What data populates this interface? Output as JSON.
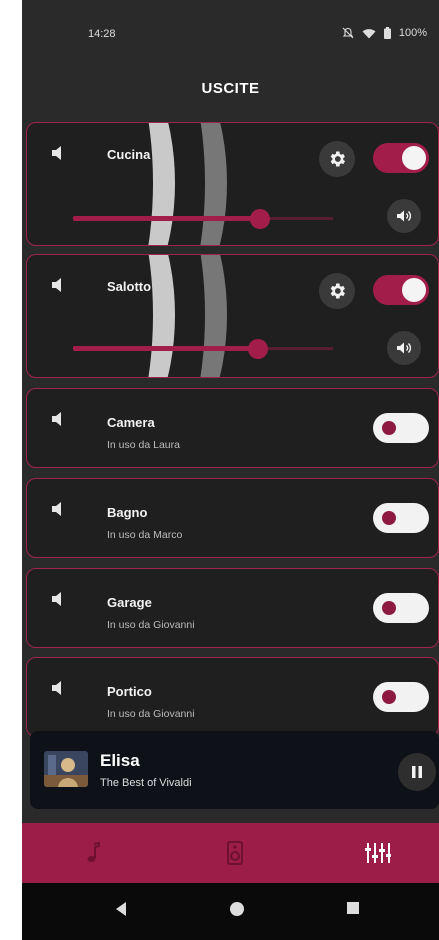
{
  "status": {
    "time": "14:28",
    "battery": "100%"
  },
  "header": {
    "title": "USCITE"
  },
  "outputs": [
    {
      "name": "Cucina",
      "enabled": true,
      "volume": 0.72
    },
    {
      "name": "Salotto",
      "enabled": true,
      "volume": 0.71
    },
    {
      "name": "Camera",
      "status": "In uso da Laura",
      "enabled": false
    },
    {
      "name": "Bagno",
      "status": "In uso da Marco",
      "enabled": false
    },
    {
      "name": "Garage",
      "status": "In uso da Giovanni",
      "enabled": false
    },
    {
      "name": "Portico",
      "status": "In uso da Giovanni",
      "enabled": false
    }
  ],
  "now_playing": {
    "title": "Elisa",
    "subtitle": "The Best of Vivaldi"
  },
  "nav": {
    "items": [
      "music-note-icon",
      "speaker-device-icon",
      "equalizer-icon"
    ],
    "active": 2
  },
  "colors": {
    "accent": "#a31d4b",
    "background": "#2a2a2a",
    "card": "#1f1f1f",
    "nav_bar": "#9c1d47"
  }
}
